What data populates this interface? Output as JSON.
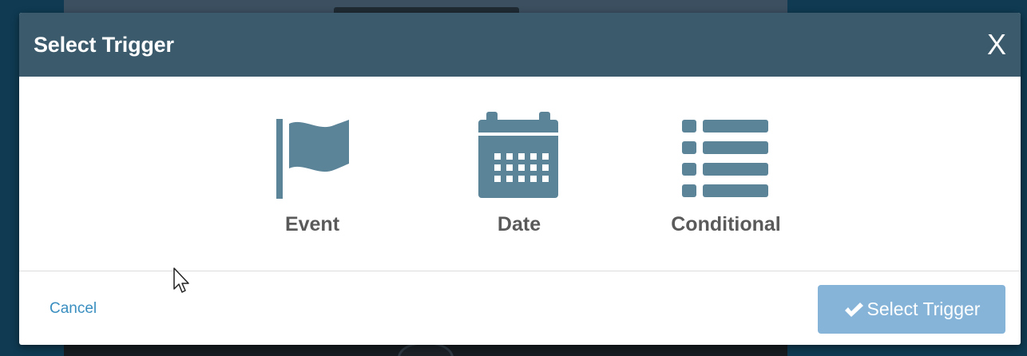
{
  "modal": {
    "title": "Select Trigger",
    "close_label": "X"
  },
  "options": [
    {
      "label": "Event",
      "icon": "flag-icon"
    },
    {
      "label": "Date",
      "icon": "calendar-icon"
    },
    {
      "label": "Conditional",
      "icon": "list-icon"
    }
  ],
  "footer": {
    "cancel_label": "Cancel",
    "select_label": "Select Trigger"
  },
  "colors": {
    "header": "#3b5a6b",
    "icon": "#5b8499",
    "label": "#5a5a5a",
    "link": "#3a8fc0",
    "button_disabled": "#86b4d8",
    "backdrop": "#0f3a52"
  }
}
